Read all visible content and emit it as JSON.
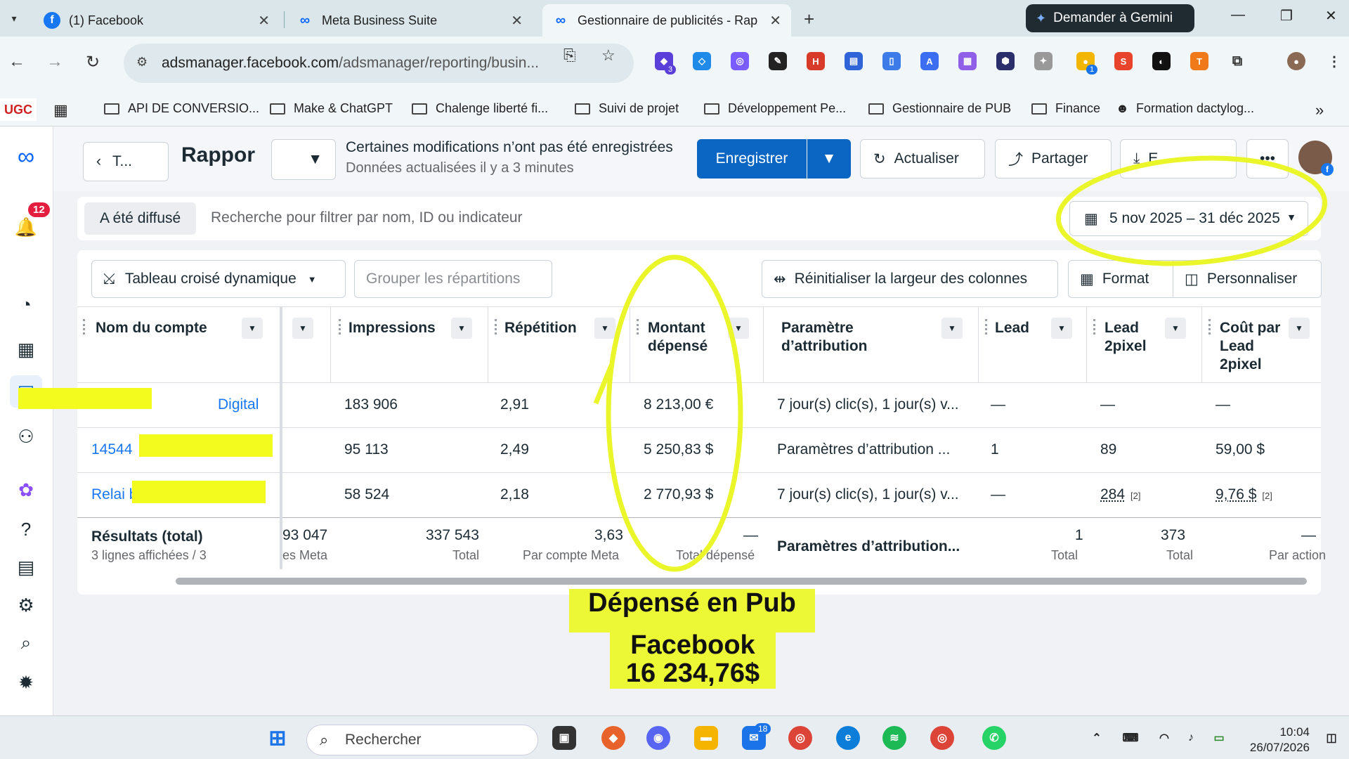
{
  "browser": {
    "tabs": [
      {
        "title": "(1) Facebook"
      },
      {
        "title": "Meta Business Suite"
      },
      {
        "title": "Gestionnaire de publicités - Rap"
      }
    ],
    "gemini_label": "Demander à Gemini",
    "url_host": "adsmanager.facebook.com",
    "url_path": "/adsmanager/reporting/busin...",
    "ext_badges": {
      "b1": "3",
      "b2": "1"
    },
    "bookmarks": {
      "ugc": "UGC",
      "items": [
        "API DE CONVERSIO...",
        "Make & ChatGPT",
        "Chalenge liberté fi...",
        "Suivi de projet",
        "Développement Pe...",
        "Gestionnaire de PUB",
        "Finance",
        "Formation dactylog..."
      ]
    }
  },
  "rail": {
    "notif_count": "12"
  },
  "header": {
    "back_label": "T...",
    "title": "Rappor",
    "unsaved_msg": "Certaines modifications n’ont pas été enregistrées",
    "updated_msg": "Données actualisées il y a 3 minutes",
    "save_label": "Enregistrer",
    "refresh_label": "Actualiser",
    "share_label": "Partager",
    "export_partial": "E..."
  },
  "filter": {
    "chip": "A été diffusé",
    "placeholder": "Recherche pour filtrer par nom, ID ou indicateur",
    "date_range": "5 nov 2025 – 31 déc 2025"
  },
  "toolbar": {
    "pivot": "Tableau croisé dynamique",
    "group": "Grouper les répartitions",
    "reset_width": "Réinitialiser la largeur des colonnes",
    "format": "Format",
    "customize": "Personnaliser"
  },
  "table": {
    "columns": {
      "account": "Nom du compte",
      "impressions": "Impressions",
      "repetition": "Répétition",
      "spent_l1": "Montant",
      "spent_l2": "dépensé",
      "attr_l1": "Paramètre",
      "attr_l2": "d’attribution",
      "lead": "Lead",
      "lead2_l1": "Lead",
      "lead2_l2": "2pixel",
      "cost_l1": "Coût par",
      "cost_l2": "Lead",
      "cost_l3": "2pixel"
    },
    "rows": [
      {
        "account": "Digital",
        "impressions": "183 906",
        "repetition": "2,91",
        "spent": "8 213,00 €",
        "attribution": "7 jour(s) clic(s), 1 jour(s) v...",
        "lead": "—",
        "lead2": "—",
        "cost": "—"
      },
      {
        "account": "14544",
        "impressions": "95 113",
        "repetition": "2,49",
        "spent": "5 250,83 $",
        "attribution": "Paramètres d’attribution ...",
        "lead": "1",
        "lead2": "89",
        "cost": "59,00 $"
      },
      {
        "account": "Relai b",
        "impressions": "58 524",
        "repetition": "2,18",
        "spent": "2 770,93 $",
        "attribution": "7 jour(s) clic(s), 1 jour(s) v...",
        "lead": "—",
        "lead2": "284",
        "lead2_note": "[2]",
        "cost": "9,76 $",
        "cost_note": "[2]"
      }
    ],
    "totals": {
      "label": "Résultats (total)",
      "sub": "3 lignes affichées / 3",
      "hidden_val": "93 047",
      "hidden_sub": "es Meta",
      "impressions": "337 543",
      "impressions_sub": "Total",
      "repetition": "3,63",
      "repetition_sub": "Par compte Meta",
      "spent": "—",
      "spent_sub": "Total dépensé",
      "attribution": "Paramètres d’attribution...",
      "lead": "1",
      "lead_sub": "Total",
      "lead2": "373",
      "lead2_sub": "Total",
      "cost": "—",
      "cost_sub": "Par action"
    }
  },
  "annotation": {
    "line1": "Dépensé en Pub",
    "line2": "Facebook",
    "line3": "16 234,76$"
  },
  "taskbar": {
    "search": "Rechercher",
    "badge_mail": "18",
    "time": "10:04",
    "date": "26/07/2026"
  },
  "colors": {
    "accent": "#0a66c2",
    "link": "#1877f2",
    "highlight": "#ecf735"
  }
}
